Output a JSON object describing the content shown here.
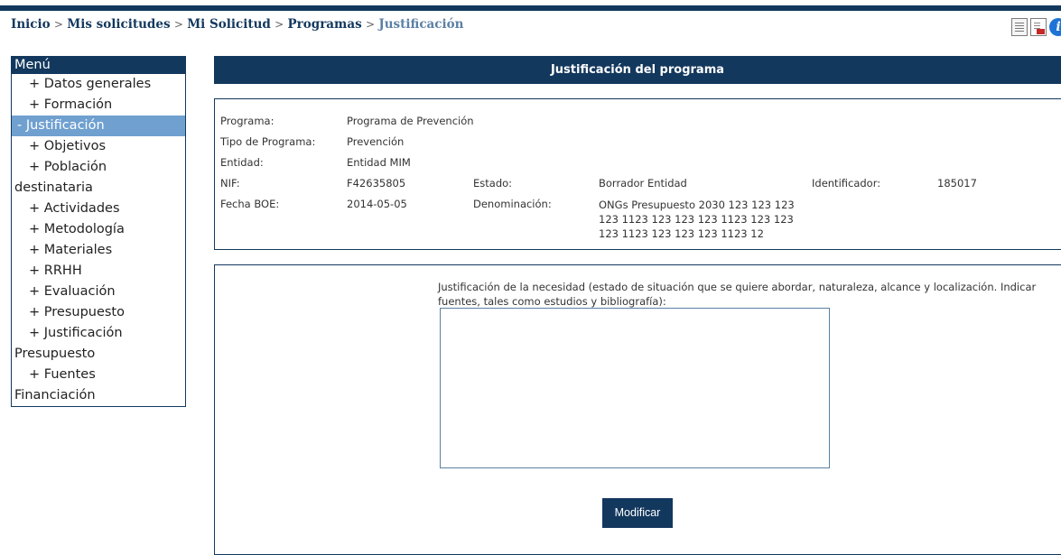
{
  "breadcrumb": {
    "items": [
      "Inicio",
      "Mis solicitudes",
      "Mi Solicitud",
      "Programas"
    ],
    "separator": ">",
    "current": "Justificación"
  },
  "header_icons": [
    "document-list-icon",
    "pdf-report-icon",
    "info-icon"
  ],
  "menu": {
    "title": "Menú",
    "items": [
      {
        "prefix": "+",
        "label": "Datos generales",
        "active": false
      },
      {
        "prefix": "+",
        "label": "Formación",
        "active": false
      },
      {
        "prefix": "-",
        "label": "Justificación",
        "active": true
      },
      {
        "prefix": "+",
        "label": "Objetivos",
        "active": false
      },
      {
        "prefix": "+",
        "label": "Población",
        "continuation": "destinataria",
        "active": false
      },
      {
        "prefix": "+",
        "label": "Actividades",
        "active": false
      },
      {
        "prefix": "+",
        "label": "Metodología",
        "active": false
      },
      {
        "prefix": "+",
        "label": "Materiales",
        "active": false
      },
      {
        "prefix": "+",
        "label": "RRHH",
        "active": false
      },
      {
        "prefix": "+",
        "label": "Evaluación",
        "active": false
      },
      {
        "prefix": "+",
        "label": "Presupuesto",
        "active": false
      },
      {
        "prefix": "+",
        "label": "Justificación",
        "continuation": "Presupuesto",
        "active": false
      },
      {
        "prefix": "+",
        "label": "Fuentes",
        "continuation": "Financiación",
        "active": false
      }
    ]
  },
  "panel": {
    "title": "Justificación del programa"
  },
  "info": {
    "programa_label": "Programa:",
    "programa_value": "Programa de Prevención",
    "tipo_label": "Tipo de Programa:",
    "tipo_value": "Prevención",
    "entidad_label": "Entidad:",
    "entidad_value": "Entidad MIM",
    "nif_label": "NIF:",
    "nif_value": "F42635805",
    "estado_label": "Estado:",
    "estado_value": "Borrador Entidad",
    "identificador_label": "Identificador:",
    "identificador_value": "185017",
    "fecha_label": "Fecha BOE:",
    "fecha_value": "2014-05-05",
    "denominacion_label": "Denominación:",
    "denominacion_value": "ONGs Presupuesto 2030 123 123 123 123 1123 123 123 123 1123 123 123 123 1123 123 123 123 1123 12"
  },
  "form": {
    "field_label": "Justificación de la necesidad (estado de situación que se quiere abordar, naturaleza, alcance y localización. Indicar fuentes, tales como estudios y bibliografía):",
    "field_value": "",
    "submit_label": "Modificar"
  },
  "colors": {
    "primary": "#13385e",
    "active_menu": "#6fa0d0",
    "breadcrumb_current": "#5b80a5"
  }
}
